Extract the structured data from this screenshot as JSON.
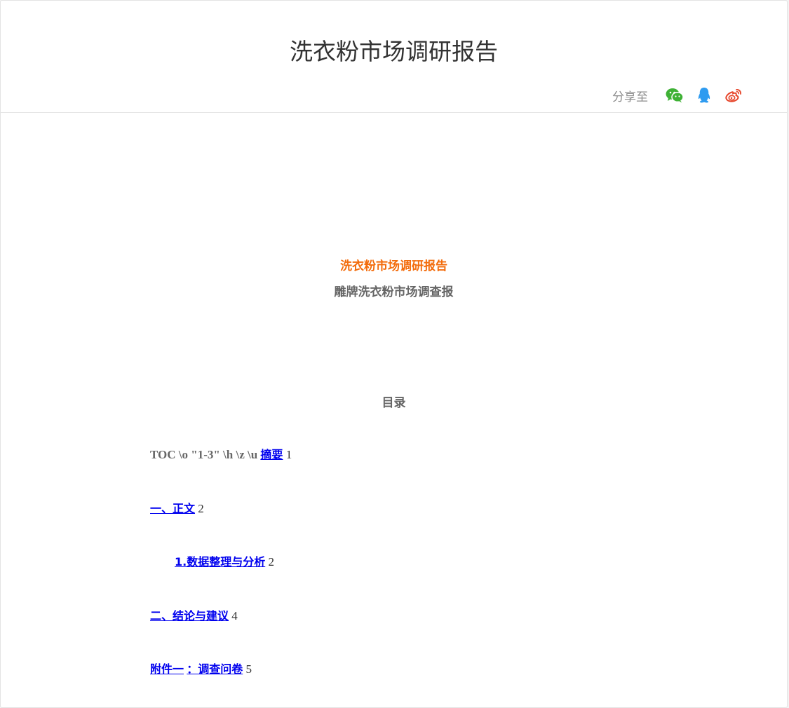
{
  "header": {
    "title": "洗衣粉市场调研报告",
    "share_label": "分享至",
    "share_targets": [
      {
        "name": "wechat-icon",
        "color": "#3eb135"
      },
      {
        "name": "qq-icon",
        "color": "#2e9bf0"
      },
      {
        "name": "weibo-icon",
        "color": "#e6452a"
      }
    ]
  },
  "document": {
    "title": "洗衣粉市场调研报告",
    "subtitle": "雕牌洗衣粉市场调查报",
    "toc_heading": "目录",
    "toc_field_code": "TOC \\o \"1-3\" \\h \\z \\u",
    "toc": [
      {
        "label": "摘要",
        "page": "1"
      },
      {
        "label": "一、正文",
        "page": "2"
      },
      {
        "label": "1.数据整理与分析",
        "page": "2"
      },
      {
        "label": "二、结论与建议",
        "page": "4"
      },
      {
        "label": "附件一",
        "label2": "：调查问卷",
        "page": "5"
      }
    ]
  },
  "colors": {
    "accent": "#f36c0c",
    "link": "#0000ee",
    "muted_text": "#666666"
  }
}
